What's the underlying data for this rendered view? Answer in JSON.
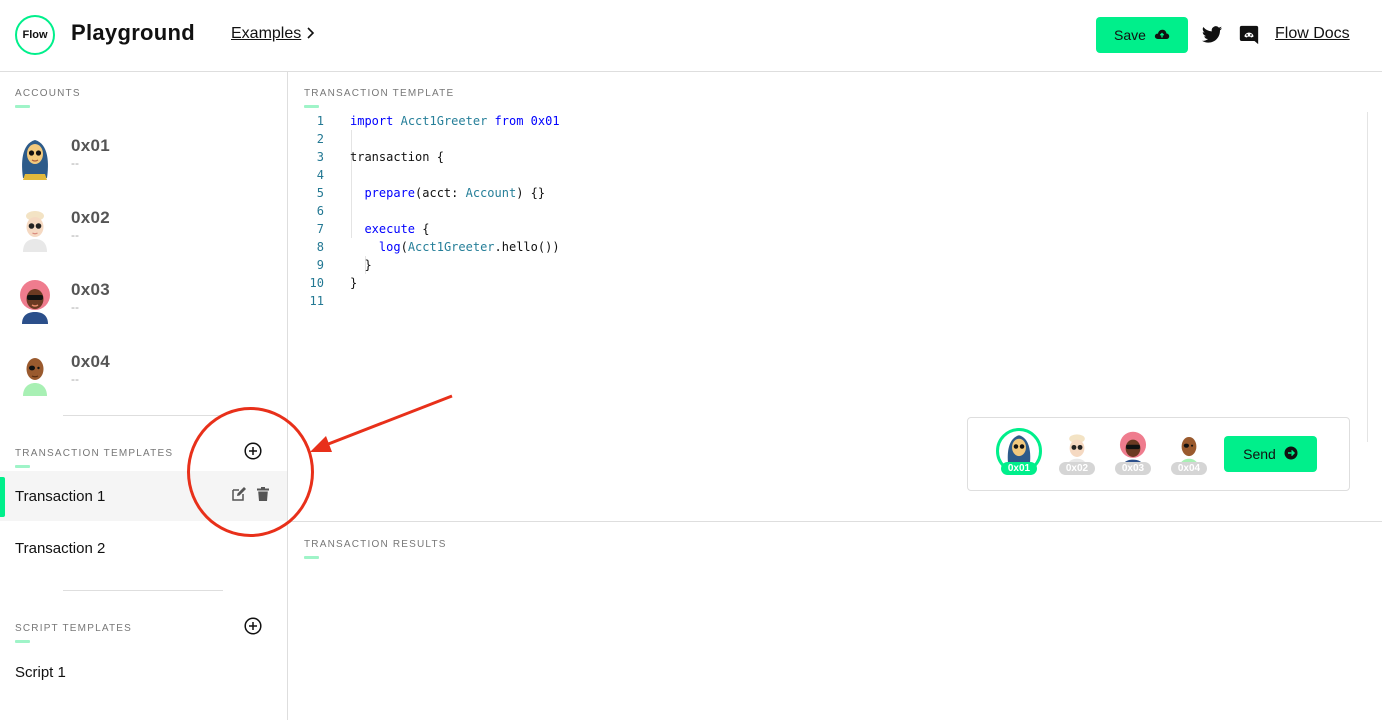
{
  "header": {
    "logo_text": "Flow",
    "title": "Playground",
    "examples_label": "Examples",
    "save_label": "Save",
    "docs_label": "Flow Docs"
  },
  "sidebar": {
    "accounts_label": "ACCOUNTS",
    "accounts": [
      {
        "address": "0x01",
        "sub": "--"
      },
      {
        "address": "0x02",
        "sub": "--"
      },
      {
        "address": "0x03",
        "sub": "--"
      },
      {
        "address": "0x04",
        "sub": "--"
      }
    ],
    "transaction_templates_label": "TRANSACTION TEMPLATES",
    "transactions": [
      "Transaction 1",
      "Transaction 2"
    ],
    "script_templates_label": "SCRIPT TEMPLATES",
    "scripts": [
      "Script 1"
    ]
  },
  "editor": {
    "label": "TRANSACTION TEMPLATE",
    "line_numbers": [
      "1",
      "2",
      "3",
      "4",
      "5",
      "6",
      "7",
      "8",
      "9",
      "10",
      "11"
    ]
  },
  "signers": {
    "labels": [
      "0x01",
      "0x02",
      "0x03",
      "0x04"
    ],
    "selected": "0x01",
    "send_label": "Send"
  },
  "results": {
    "label": "TRANSACTION RESULTS"
  },
  "colors": {
    "accent": "#00ef8b",
    "annotation": "#e8301a"
  }
}
